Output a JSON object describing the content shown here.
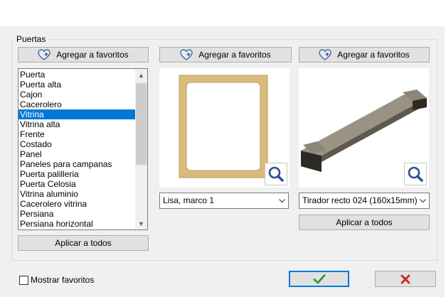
{
  "group": {
    "title": "Puertas"
  },
  "favorites_buttons": [
    {
      "label": "Agregar a favoritos"
    },
    {
      "label": "Agregar a favoritos"
    },
    {
      "label": "Agregar a favoritos"
    }
  ],
  "list": {
    "items": [
      {
        "label": "Puerta"
      },
      {
        "label": "Puerta alta"
      },
      {
        "label": "Cajon"
      },
      {
        "label": "Cacerolero"
      },
      {
        "label": "Vitrina",
        "selected": true
      },
      {
        "label": "Vitrina alta"
      },
      {
        "label": "Frente"
      },
      {
        "label": "Costado"
      },
      {
        "label": "Panel"
      },
      {
        "label": "Paneles para campanas"
      },
      {
        "label": "Puerta palilleria"
      },
      {
        "label": "Puerta Celosia"
      },
      {
        "label": "Vitrina aluminio"
      },
      {
        "label": "Cacerolero vitrina"
      },
      {
        "label": "Persiana"
      },
      {
        "label": "Persiana horizontal"
      }
    ]
  },
  "door_style": {
    "selected": "Lisa, marco 1"
  },
  "handle_style": {
    "selected": "Tirador recto 024 (160x15mm)"
  },
  "apply_all": {
    "list_label": "Aplicar a todos",
    "handle_label": "Aplicar a todos"
  },
  "show_favorites": {
    "label": "Mostrar favoritos",
    "checked": false
  },
  "colors": {
    "accent": "#0078d7",
    "ok": "#2e9b2e",
    "cancel": "#c42b1c",
    "wood": "#d9bb7c"
  }
}
